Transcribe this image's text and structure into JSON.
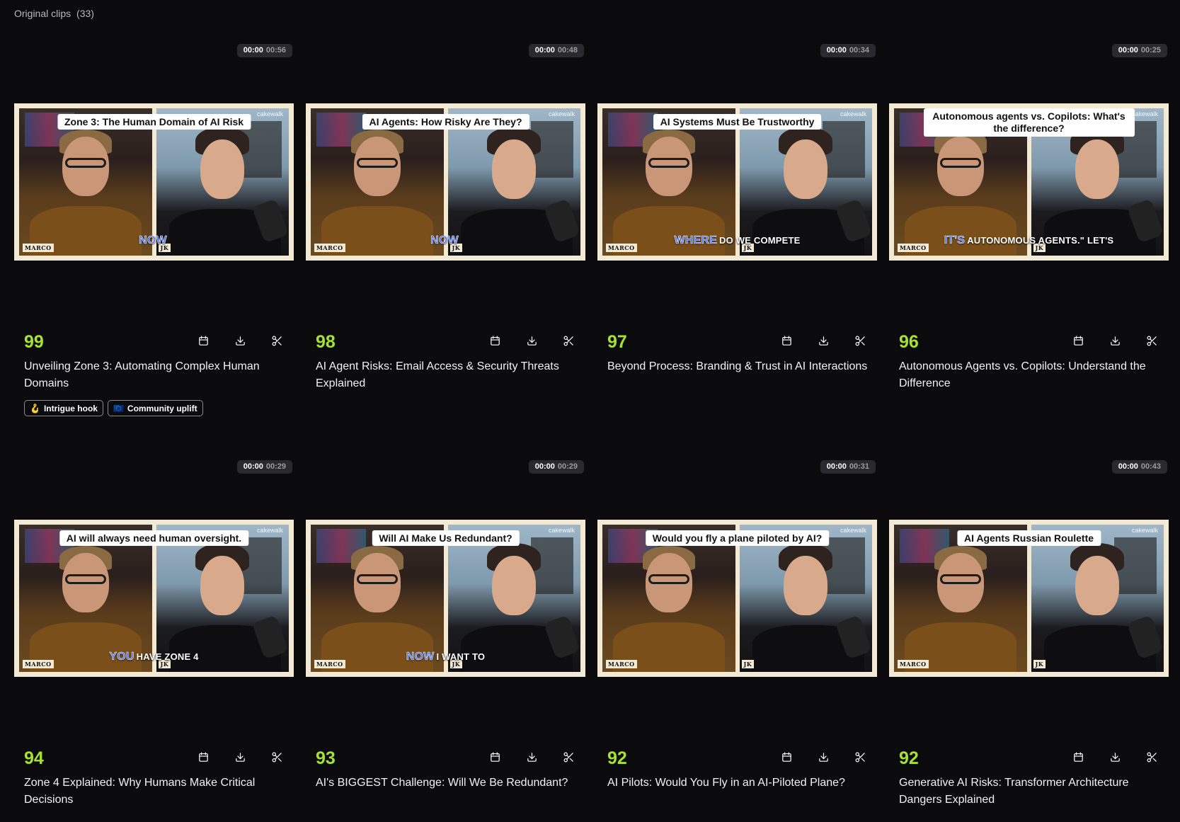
{
  "header": {
    "title": "Original clips",
    "count": "(33)"
  },
  "clips": [
    {
      "score": "99",
      "title": "Unveiling Zone 3: Automating Complex Human Domains",
      "time_current": "00:00",
      "time_total": "00:56",
      "banner": "Zone 3: The Human Domain of AI Risk",
      "caption_hl": "NOW",
      "caption_rest": "",
      "left_tag": "MARCO",
      "right_tag": "JK",
      "brand": "cakewalk",
      "tags": [
        {
          "icon": "🪝",
          "label": "Intrigue hook"
        },
        {
          "icon": "🇪🇺",
          "label": "Community uplift"
        }
      ]
    },
    {
      "score": "98",
      "title": "AI Agent Risks: Email Access & Security Threats Explained",
      "time_current": "00:00",
      "time_total": "00:48",
      "banner": "AI Agents: How Risky Are They?",
      "caption_hl": "NOW",
      "caption_rest": "",
      "left_tag": "MARCO",
      "right_tag": "JK",
      "brand": "cakewalk",
      "tags": []
    },
    {
      "score": "97",
      "title": "Beyond Process: Branding & Trust in AI Interactions",
      "time_current": "00:00",
      "time_total": "00:34",
      "banner": "AI Systems Must Be Trustworthy",
      "caption_hl": "WHERE",
      "caption_rest": "DO WE COMPETE",
      "left_tag": "MARCO",
      "right_tag": "JK",
      "brand": "cakewalk",
      "tags": []
    },
    {
      "score": "96",
      "title": "Autonomous Agents vs. Copilots: Understand the Difference",
      "time_current": "00:00",
      "time_total": "00:25",
      "banner": "Autonomous agents vs. Copilots: What's the difference?",
      "caption_hl": "IT'S",
      "caption_rest": "AUTONOMOUS AGENTS.\" LET'S",
      "left_tag": "MARCO",
      "right_tag": "JK",
      "brand": "cakewalk",
      "tags": []
    },
    {
      "score": "94",
      "title": "Zone 4 Explained: Why Humans Make Critical Decisions",
      "time_current": "00:00",
      "time_total": "00:29",
      "banner": "AI will always need human oversight.",
      "caption_hl": "YOU",
      "caption_rest": "HAVE ZONE 4",
      "left_tag": "MARCO",
      "right_tag": "JK",
      "brand": "cakewalk",
      "tags": []
    },
    {
      "score": "93",
      "title": "AI's BIGGEST Challenge: Will We Be Redundant?",
      "time_current": "00:00",
      "time_total": "00:29",
      "banner": "Will AI Make Us Redundant?",
      "caption_hl": "NOW",
      "caption_rest": "I WANT TO",
      "left_tag": "MARCO",
      "right_tag": "JK",
      "brand": "cakewalk",
      "tags": []
    },
    {
      "score": "92",
      "title": "AI Pilots: Would You Fly in an AI-Piloted Plane?",
      "time_current": "00:00",
      "time_total": "00:31",
      "banner": "Would you fly a plane piloted by AI?",
      "caption_hl": "",
      "caption_rest": "",
      "left_tag": "MARCO",
      "right_tag": "JK",
      "brand": "cakewalk",
      "tags": []
    },
    {
      "score": "92",
      "title": "Generative AI Risks: Transformer Architecture Dangers Explained",
      "time_current": "00:00",
      "time_total": "00:43",
      "banner": "AI Agents Russian Roulette",
      "caption_hl": "",
      "caption_rest": "",
      "left_tag": "MARCO",
      "right_tag": "JK",
      "brand": "cakewalk",
      "tags": []
    }
  ],
  "icons": {
    "schedule": "calendar-icon",
    "download": "download-icon",
    "edit": "scissors-icon"
  },
  "colors": {
    "score": "#a6e22e",
    "caption_highlight": "#4a6ee8",
    "background": "#0b0b0d"
  }
}
